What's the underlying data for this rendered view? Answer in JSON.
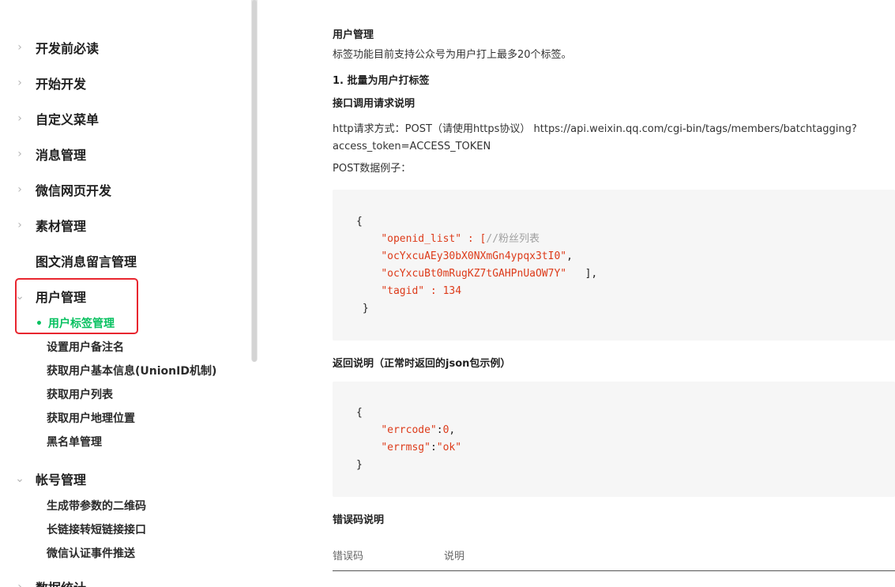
{
  "sidebar": {
    "items": [
      {
        "label": "开发前必读",
        "chevron": "›"
      },
      {
        "label": "开始开发",
        "chevron": "›"
      },
      {
        "label": "自定义菜单",
        "chevron": "›"
      },
      {
        "label": "消息管理",
        "chevron": "›"
      },
      {
        "label": "微信网页开发",
        "chevron": "›"
      },
      {
        "label": "素材管理",
        "chevron": "›"
      },
      {
        "label": "图文消息留言管理",
        "chevron": ""
      },
      {
        "label": "用户管理",
        "chevron": "⌄"
      },
      {
        "label": "帐号管理",
        "chevron": "⌄"
      },
      {
        "label": "数据统计",
        "chevron": "›"
      }
    ],
    "user_sub": [
      {
        "label": "用户标签管理",
        "active": true
      },
      {
        "label": "设置用户备注名"
      },
      {
        "label": "获取用户基本信息(UnionID机制)"
      },
      {
        "label": "获取用户列表"
      },
      {
        "label": "获取用户地理位置"
      },
      {
        "label": "黑名单管理"
      }
    ],
    "account_sub": [
      {
        "label": "生成带参数的二维码"
      },
      {
        "label": "长链接转短链接接口"
      },
      {
        "label": "微信认证事件推送"
      }
    ],
    "active_dot": "•",
    "accent_color": "#07c160",
    "highlight_color": "#e8262f"
  },
  "main": {
    "section_title": "用户管理",
    "intro": "标签功能目前支持公众号为用户打上最多20个标签。",
    "step_title": "1. 批量为用户打标签",
    "request_title": "接口调用请求说明",
    "http_line1": "http请求方式：POST（请使用https协议） https://api.weixin.qq.com/cgi-bin/tags/members/batchtagging?",
    "http_line2": "access_token=ACCESS_TOKEN",
    "post_example": "POST数据例子：",
    "code1": {
      "open": "{",
      "key1": "\"openid_list\"",
      "sep1": " : [",
      "comment": "//粉丝列表",
      "val1": "\"ocYxcuAEy30bX0NXmGn4ypqx3tI0\"",
      "comma": ",",
      "val2": "\"ocYxcuBt0mRugKZ7tGAHPnUaOW7Y\"",
      "close_arr": "   ],",
      "key2": "\"tagid\"",
      "sep2": " : ",
      "num": "134",
      "close": "}"
    },
    "return_title": "返回说明（正常时返回的json包示例）",
    "code2": {
      "open": "{",
      "key1": "\"errcode\"",
      "sep1": ":",
      "num": "0",
      "comma": ",",
      "key2": "\"errmsg\"",
      "sep2": ":",
      "val2": "\"ok\"",
      "close": "}"
    },
    "error_title": "错误码说明",
    "table_headers": [
      "错误码",
      "说明"
    ],
    "code_string_color": "#dd3b1a",
    "code_comment_color": "#a0a0a0"
  }
}
